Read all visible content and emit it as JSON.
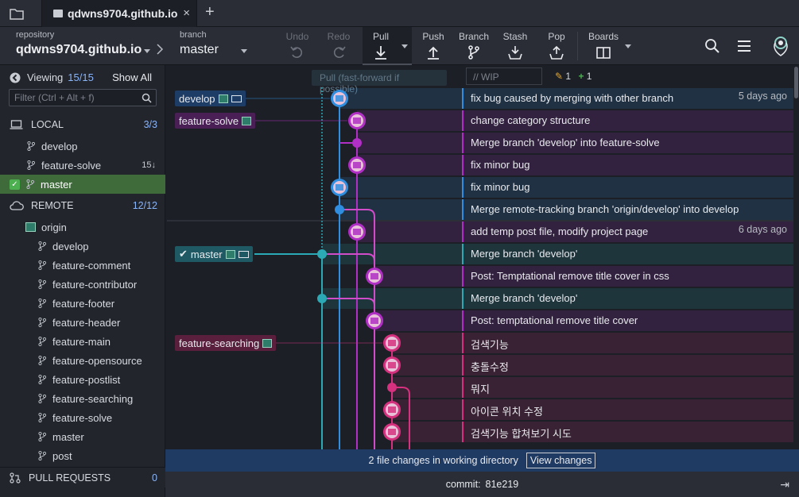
{
  "titlebar": {
    "tab_label": "qdwns9704.github.io",
    "close_glyph": "×",
    "new_tab_glyph": "+"
  },
  "toolbar": {
    "repository_caption": "repository",
    "repository_name": "qdwns9704.github.io",
    "branch_caption": "branch",
    "branch_name": "master",
    "undo": "Undo",
    "redo": "Redo",
    "pull": "Pull",
    "push": "Push",
    "branch": "Branch",
    "stash": "Stash",
    "pop": "Pop",
    "boards": "Boards"
  },
  "sidebar": {
    "viewing_label": "Viewing",
    "viewing_count": "15/15",
    "show_all": "Show All",
    "filter_placeholder": "Filter (Ctrl + Alt + f)",
    "local_label": "LOCAL",
    "local_count": "3/3",
    "local_branches": [
      {
        "name": "develop",
        "badge": ""
      },
      {
        "name": "feature-solve",
        "badge": "15↓"
      },
      {
        "name": "master",
        "badge": ""
      }
    ],
    "remote_label": "REMOTE",
    "remote_count": "12/12",
    "remote_origin": "origin",
    "remote_branches": [
      "develop",
      "feature-comment",
      "feature-contributor",
      "feature-footer",
      "feature-header",
      "feature-main",
      "feature-opensource",
      "feature-postlist",
      "feature-searching",
      "feature-solve",
      "master",
      "post"
    ],
    "pull_requests_label": "PULL REQUESTS",
    "pull_requests_count": "0"
  },
  "graph_header": {
    "ghost_text": "Pull (fast-forward if possible)",
    "wip_placeholder": "// WIP",
    "edits": "1",
    "adds": "1"
  },
  "commits": [
    {
      "message": "fix bug caused by merging with other branch",
      "date": "5 days ago",
      "ref": "develop"
    },
    {
      "message": "change category structure",
      "date": "",
      "ref": "feature-solve"
    },
    {
      "message": "Merge branch 'develop' into feature-solve",
      "date": "",
      "ref": ""
    },
    {
      "message": "fix minor bug",
      "date": "",
      "ref": ""
    },
    {
      "message": "fix minor bug",
      "date": "",
      "ref": ""
    },
    {
      "message": "Merge remote-tracking branch 'origin/develop' into develop",
      "date": "",
      "ref": ""
    },
    {
      "message": "add temp post file, modify project page",
      "date": "6 days ago",
      "ref": ""
    },
    {
      "message": "Merge branch 'develop'",
      "date": "",
      "ref": "master"
    },
    {
      "message": "Post: Temptational remove title cover in css",
      "date": "",
      "ref": ""
    },
    {
      "message": "Merge branch 'develop'",
      "date": "",
      "ref": ""
    },
    {
      "message": "Post: temptational remove title cover",
      "date": "",
      "ref": ""
    },
    {
      "message": "검색기능",
      "date": "",
      "ref": "feature-searching"
    },
    {
      "message": "충돌수정",
      "date": "",
      "ref": ""
    },
    {
      "message": "뭐지",
      "date": "",
      "ref": ""
    },
    {
      "message": "아이콘 위치 수정",
      "date": "",
      "ref": ""
    },
    {
      "message": "검색기능 합쳐보기 시도",
      "date": "",
      "ref": ""
    }
  ],
  "status": {
    "changes_text": "2 file changes in working directory",
    "view_changes": "View changes"
  },
  "footer": {
    "commit_label": "commit:",
    "commit_sha": "81e219"
  },
  "colors": {
    "develop": "#2f8ee0",
    "feature_solve": "#b02fc4",
    "master": "#2ba9b5",
    "feature_searching": "#d6317f",
    "selection": "#3f6b3a"
  }
}
